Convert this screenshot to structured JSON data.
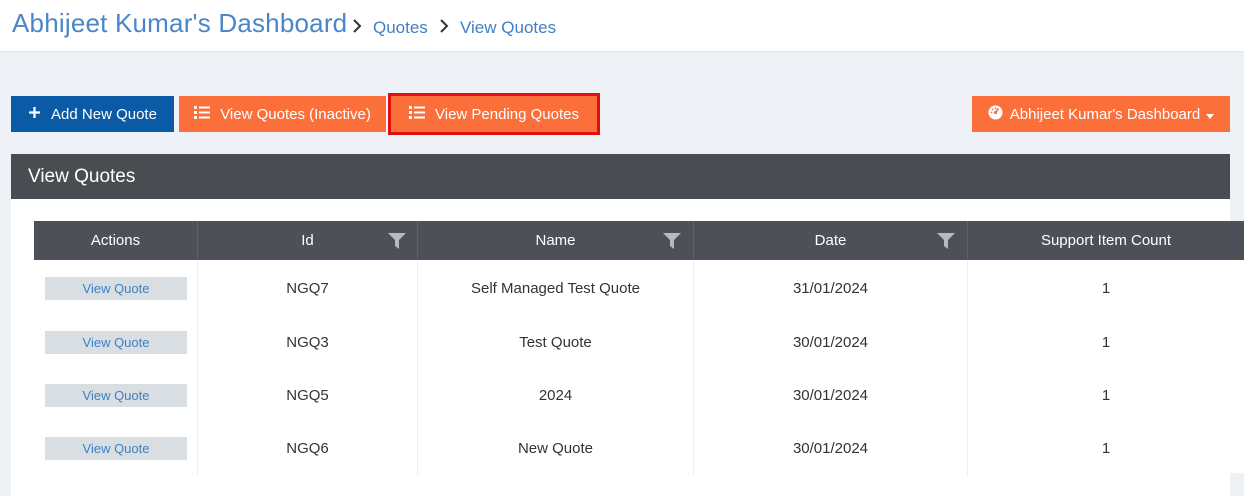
{
  "header": {
    "title": "Abhijeet Kumar's Dashboard",
    "breadcrumbs": [
      "Quotes",
      "View Quotes"
    ]
  },
  "toolbar": {
    "add_label": "Add New Quote",
    "inactive_label": "View Quotes (Inactive)",
    "pending_label": "View Pending Quotes",
    "dashboard_label": "Abhijeet Kumar's Dashboard"
  },
  "panel": {
    "title": "View Quotes"
  },
  "table": {
    "columns": [
      "Actions",
      "Id",
      "Name",
      "Date",
      "Support Item Count"
    ],
    "rows": [
      {
        "action": "View Quote",
        "id": "NGQ7",
        "name": "Self Managed Test Quote",
        "date": "31/01/2024",
        "count": "1"
      },
      {
        "action": "View Quote",
        "id": "NGQ3",
        "name": "Test Quote",
        "date": "30/01/2024",
        "count": "1"
      },
      {
        "action": "View Quote",
        "id": "NGQ5",
        "name": "2024",
        "date": "30/01/2024",
        "count": "1"
      },
      {
        "action": "View Quote",
        "id": "NGQ6",
        "name": "New Quote",
        "date": "30/01/2024",
        "count": "1"
      }
    ]
  },
  "colors": {
    "brand_blue": "#0a5aa6",
    "accent_orange": "#fb6f3a",
    "header_dark": "#494d52",
    "link_blue": "#3f7fc4",
    "highlight_red": "#e01010"
  },
  "icons": {
    "add": "plus-icon",
    "list": "list-icon",
    "dashboard": "dashboard-gauge-icon",
    "filter": "filter-icon",
    "breadcrumb_separator": "chevron-right-icon"
  }
}
